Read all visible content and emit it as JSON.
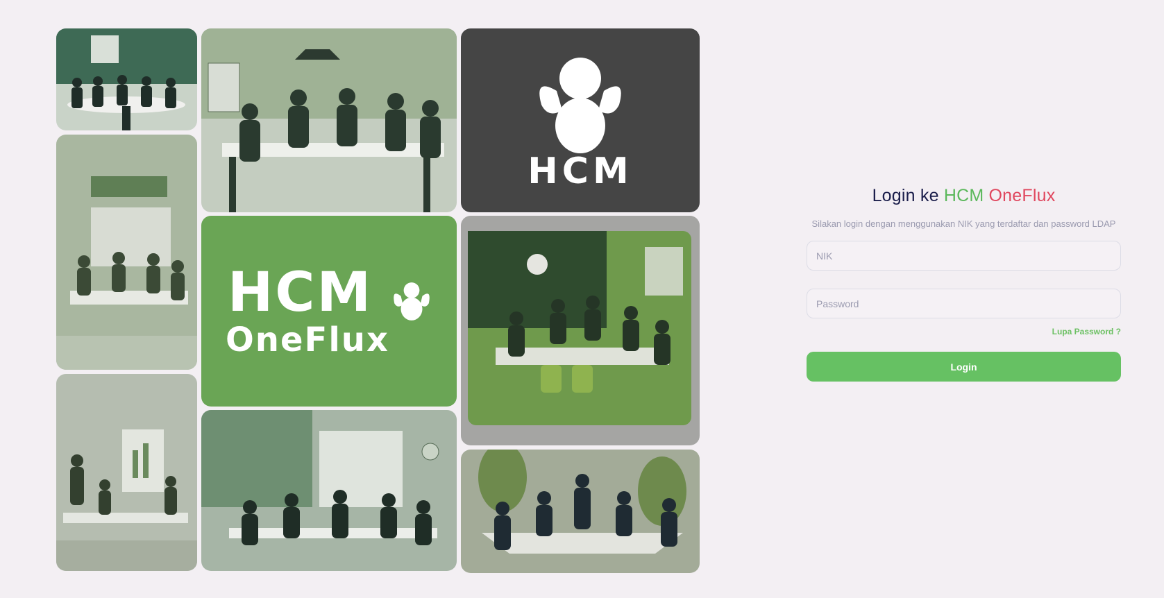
{
  "login": {
    "title_prefix": "Login ke ",
    "title_hcm": "HCM",
    "title_oneflux": "OneFlux",
    "subtitle": "Silakan login dengan menggunakan NIK yang terdaftar dan password LDAP",
    "nik_placeholder": "NIK",
    "password_placeholder": "Password",
    "forgot_label": "Lupa Password ?",
    "button_label": "Login"
  },
  "logos": {
    "dark_tile_text": "HCM",
    "green_tile_line1": "HCM",
    "green_tile_line2": "OneFlux"
  },
  "colors": {
    "background": "#f3eff3",
    "brand_green": "#66c163",
    "brand_red": "#e0475e",
    "title_navy": "#1b1e4b",
    "dark_tile": "#454545",
    "green_tile": "#6aa555"
  }
}
